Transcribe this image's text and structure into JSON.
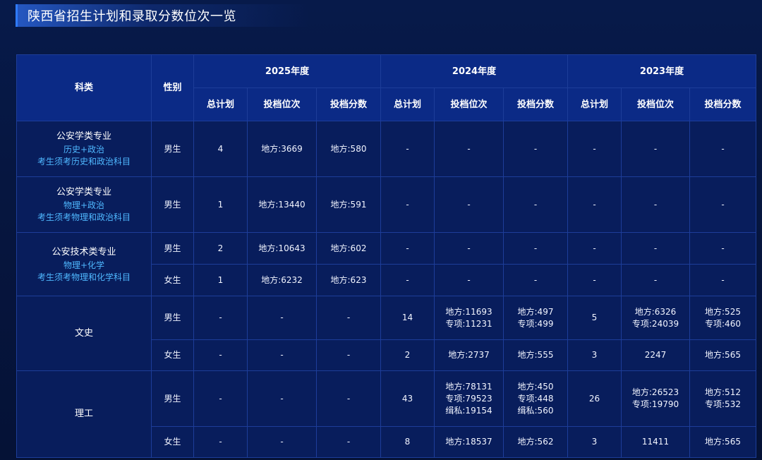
{
  "title": "陕西省招生计划和录取分数位次一览",
  "header": {
    "category": "科类",
    "gender": "性别",
    "years": [
      "2025年度",
      "2024年度",
      "2023年度"
    ],
    "sub": [
      "总计划",
      "投档位次",
      "投档分数"
    ]
  },
  "dash": "-",
  "rows": [
    {
      "category": {
        "name": "公安学类专业",
        "subject": "历史+政治",
        "note": "考生须考历史和政治科目"
      },
      "gender": "男生",
      "y2025": {
        "plan": "4",
        "rank": [
          "地方:3669"
        ],
        "score": [
          "地方:580"
        ]
      }
    },
    {
      "category": {
        "name": "公安学类专业",
        "subject": "物理+政治",
        "note": "考生须考物理和政治科目"
      },
      "gender": "男生",
      "y2025": {
        "plan": "1",
        "rank": [
          "地方:13440"
        ],
        "score": [
          "地方:591"
        ]
      }
    },
    {
      "category": {
        "name": "公安技术类专业",
        "subject": "物理+化学",
        "note": "考生须考物理和化学科目"
      },
      "gender": "男生",
      "y2025": {
        "plan": "2",
        "rank": [
          "地方:10643"
        ],
        "score": [
          "地方:602"
        ]
      }
    },
    {
      "gender": "女生",
      "y2025": {
        "plan": "1",
        "rank": [
          "地方:6232"
        ],
        "score": [
          "地方:623"
        ]
      }
    },
    {
      "category": {
        "name": "文史"
      },
      "gender": "男生",
      "y2024": {
        "plan": "14",
        "rank": [
          "地方:11693",
          "专项:11231"
        ],
        "score": [
          "地方:497",
          "专项:499"
        ]
      },
      "y2023": {
        "plan": "5",
        "rank": [
          "地方:6326",
          "专项:24039"
        ],
        "score": [
          "地方:525",
          "专项:460"
        ]
      }
    },
    {
      "gender": "女生",
      "y2024": {
        "plan": "2",
        "rank": [
          "地方:2737"
        ],
        "score": [
          "地方:555"
        ]
      },
      "y2023": {
        "plan": "3",
        "rank": [
          "2247"
        ],
        "score": [
          "地方:565"
        ]
      }
    },
    {
      "category": {
        "name": "理工"
      },
      "gender": "男生",
      "y2024": {
        "plan": "43",
        "rank": [
          "地方:78131",
          "专项:79523",
          "缉私:19154"
        ],
        "score": [
          "地方:450",
          "专项:448",
          "缉私:560"
        ]
      },
      "y2023": {
        "plan": "26",
        "rank": [
          "地方:26523",
          "专项:19790"
        ],
        "score": [
          "地方:512",
          "专项:532"
        ]
      }
    },
    {
      "gender": "女生",
      "y2024": {
        "plan": "8",
        "rank": [
          "地方:18537"
        ],
        "score": [
          "地方:562"
        ]
      },
      "y2023": {
        "plan": "3",
        "rank": [
          "11411"
        ],
        "score": [
          "地方:565"
        ]
      }
    }
  ]
}
